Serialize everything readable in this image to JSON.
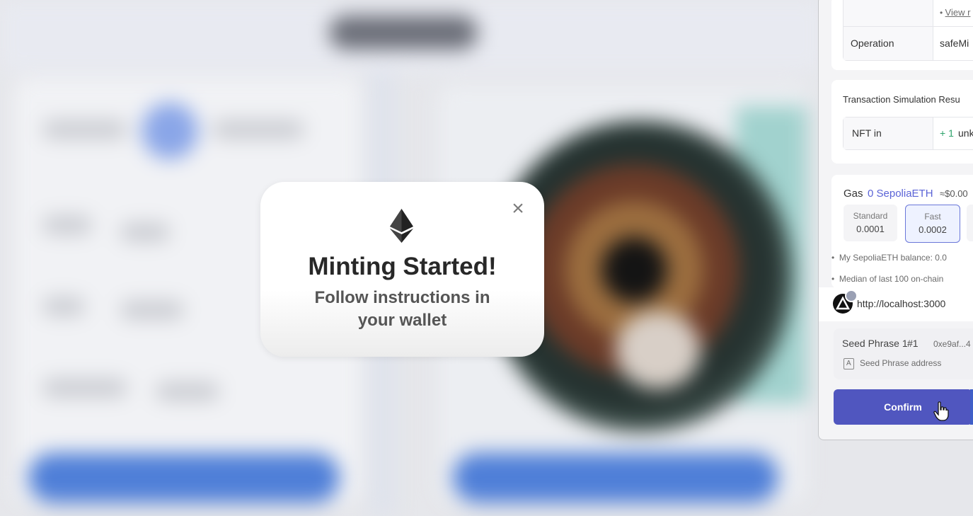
{
  "modal": {
    "title": "Minting Started!",
    "subtitle": "Follow instructions in your wallet",
    "close_icon": "×"
  },
  "wallet": {
    "view_link": "View r",
    "operation": {
      "label": "Operation",
      "value": "safeMi"
    },
    "simulation": {
      "heading": "Transaction Simulation Resu",
      "nft_label": "NFT in",
      "nft_value": "+ 1",
      "nft_suffix": "unk"
    },
    "gas": {
      "label": "Gas",
      "amount": "0 SepoliaETH",
      "usd": "≈$0.00",
      "options": [
        {
          "label": "Standard",
          "value": "0.0001",
          "selected": false
        },
        {
          "label": "Fast",
          "value": "0.0002",
          "selected": true
        }
      ],
      "balance_note": "My SepoliaETH balance: 0.0",
      "median_note": "Median of last 100 on-chain"
    },
    "site": {
      "url": "http://localhost:3000"
    },
    "account": {
      "name": "Seed Phrase 1",
      "index": "#1",
      "address": "0xe9af...4",
      "type_badge": "A",
      "type_label": "Seed Phrase address"
    },
    "confirm_label": "Confirm"
  },
  "colors": {
    "accent": "#5056bf",
    "gas_blue": "#5a63d6",
    "positive_green": "#2ea36b"
  }
}
